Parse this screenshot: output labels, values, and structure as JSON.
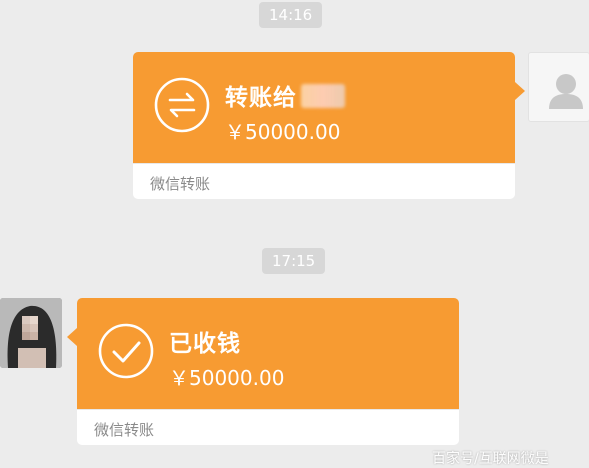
{
  "messages": [
    {
      "time": "14:16",
      "title": "转账给",
      "amount": "￥50000.00",
      "footer": "微信转账",
      "icon": "transfer-arrows-icon"
    },
    {
      "time": "17:15",
      "title": "已收钱",
      "amount": "￥50000.00",
      "footer": "微信转账",
      "icon": "check-circle-icon"
    }
  ],
  "watermark": "百家号/互联网微是",
  "colors": {
    "bubble": "#f79b32",
    "background": "#ececec",
    "time_badge": "#d7d7d7"
  }
}
